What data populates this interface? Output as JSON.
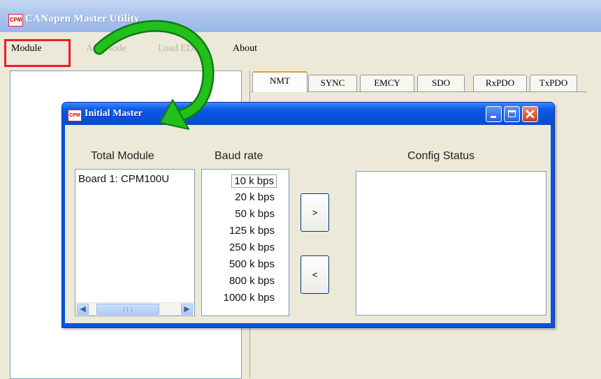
{
  "app": {
    "title": "CANopen Master Utility",
    "icon": "app-icon",
    "icon_text": "CPM"
  },
  "menu": {
    "items": [
      {
        "label": "Module",
        "enabled": true
      },
      {
        "label": "Add Node",
        "enabled": false
      },
      {
        "label": "Load EDS",
        "enabled": false
      },
      {
        "label": "About",
        "enabled": true
      }
    ]
  },
  "tabs": [
    {
      "label": "NMT",
      "active": true
    },
    {
      "label": "SYNC",
      "active": false
    },
    {
      "label": "EMCY",
      "active": false
    },
    {
      "label": "SDO",
      "active": false
    },
    {
      "label": "RxPDO",
      "active": false
    },
    {
      "label": "TxPDO",
      "active": false
    }
  ],
  "dialog": {
    "title": "Initial Master",
    "icon_text": "CPM",
    "columns": {
      "total_module": "Total Module",
      "baud_rate": "Baud rate",
      "config_status": "Config Status"
    },
    "modules": [
      "Board 1: CPM100U"
    ],
    "baud_rates": [
      "10 k bps",
      "20 k bps",
      "50 k bps",
      "125 k bps",
      "250 k bps",
      "500 k bps",
      "800 k bps",
      "1000 k bps"
    ],
    "selected_baud": "10 k bps",
    "add_button": ">",
    "remove_button": "<",
    "config_status_items": []
  },
  "colors": {
    "highlight_box": "#ef1b24",
    "annotation_arrow": "#22c01a",
    "dialog_title_bar": "#0a54e0"
  }
}
